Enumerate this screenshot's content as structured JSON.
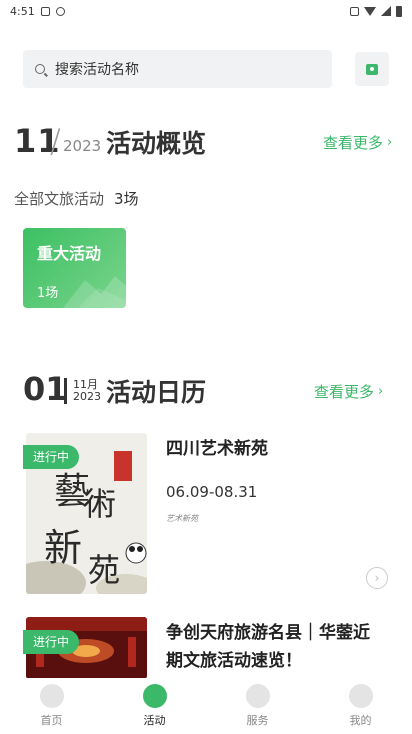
{
  "status_bar": {
    "time": "4:51"
  },
  "search": {
    "placeholder": "搜索活动名称"
  },
  "overview": {
    "month": "11",
    "year": "2023",
    "title": "活动概览",
    "more": "查看更多",
    "total_label": "全部文旅活动",
    "total_count": "3场",
    "major_card": {
      "title": "重大活动",
      "count": "1场"
    }
  },
  "calendar": {
    "day": "01",
    "month": "11月",
    "year": "2023",
    "title": "活动日历",
    "more": "查看更多"
  },
  "events": [
    {
      "tag": "进行中",
      "title": "四川艺术新苑",
      "date": "06.09-08.31",
      "subtitle": "艺术新苑",
      "poster_text": "艺術新苑"
    },
    {
      "tag": "进行中",
      "title_line1": "争创天府旅游名县｜华蓥近",
      "title_line2": "期文旅活动速览！"
    }
  ],
  "tabs": [
    {
      "label": "首页",
      "active": false
    },
    {
      "label": "活动",
      "active": true
    },
    {
      "label": "服务",
      "active": false
    },
    {
      "label": "我的",
      "active": false
    }
  ],
  "colors": {
    "accent": "#3cb86a"
  }
}
